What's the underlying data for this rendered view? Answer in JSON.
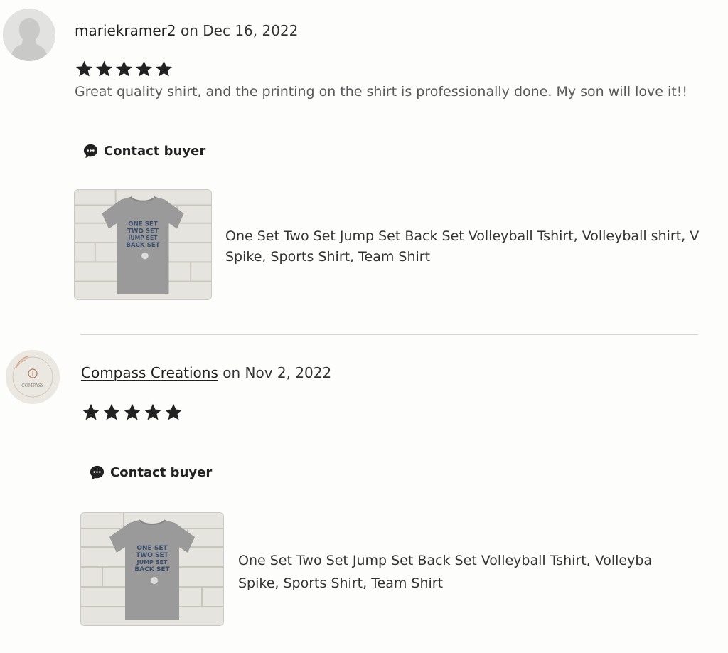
{
  "reviews": [
    {
      "reviewer": "mariekramer2",
      "date_text": "on Dec 16, 2022",
      "rating": 5,
      "text": "Great quality shirt, and the printing on the shirt is professionally done. My son will love it!!",
      "contact_label": "Contact buyer",
      "avatar_icon": "default-person-silhouette",
      "product": {
        "title_line1": "One Set Two Set Jump Set Back Set Volleyball Tshirt, Volleyball shirt, V",
        "title_line2": "Spike, Sports Shirt, Team Shirt"
      }
    },
    {
      "reviewer": "Compass Creations",
      "date_text": "on Nov 2, 2022",
      "rating": 5,
      "text": "",
      "contact_label": "Contact buyer",
      "avatar_icon": "compass-logo",
      "avatar_logo_text": "COMPASS",
      "product": {
        "title_line1": "One Set Two Set Jump Set Back Set Volleyball Tshirt, Volleyba",
        "title_line2": "Spike, Sports Shirt, Team Shirt"
      }
    }
  ],
  "product_image": {
    "print_lines": [
      "ONE SET",
      "TWO SET",
      "JUMP SET",
      "BACK SET"
    ]
  },
  "colors": {
    "star": "#222222",
    "text": "#222222",
    "muted_text": "#595959",
    "divider": "#d4d4d0",
    "shirt": "#9a9a9a",
    "print": "#3a4d6e"
  }
}
